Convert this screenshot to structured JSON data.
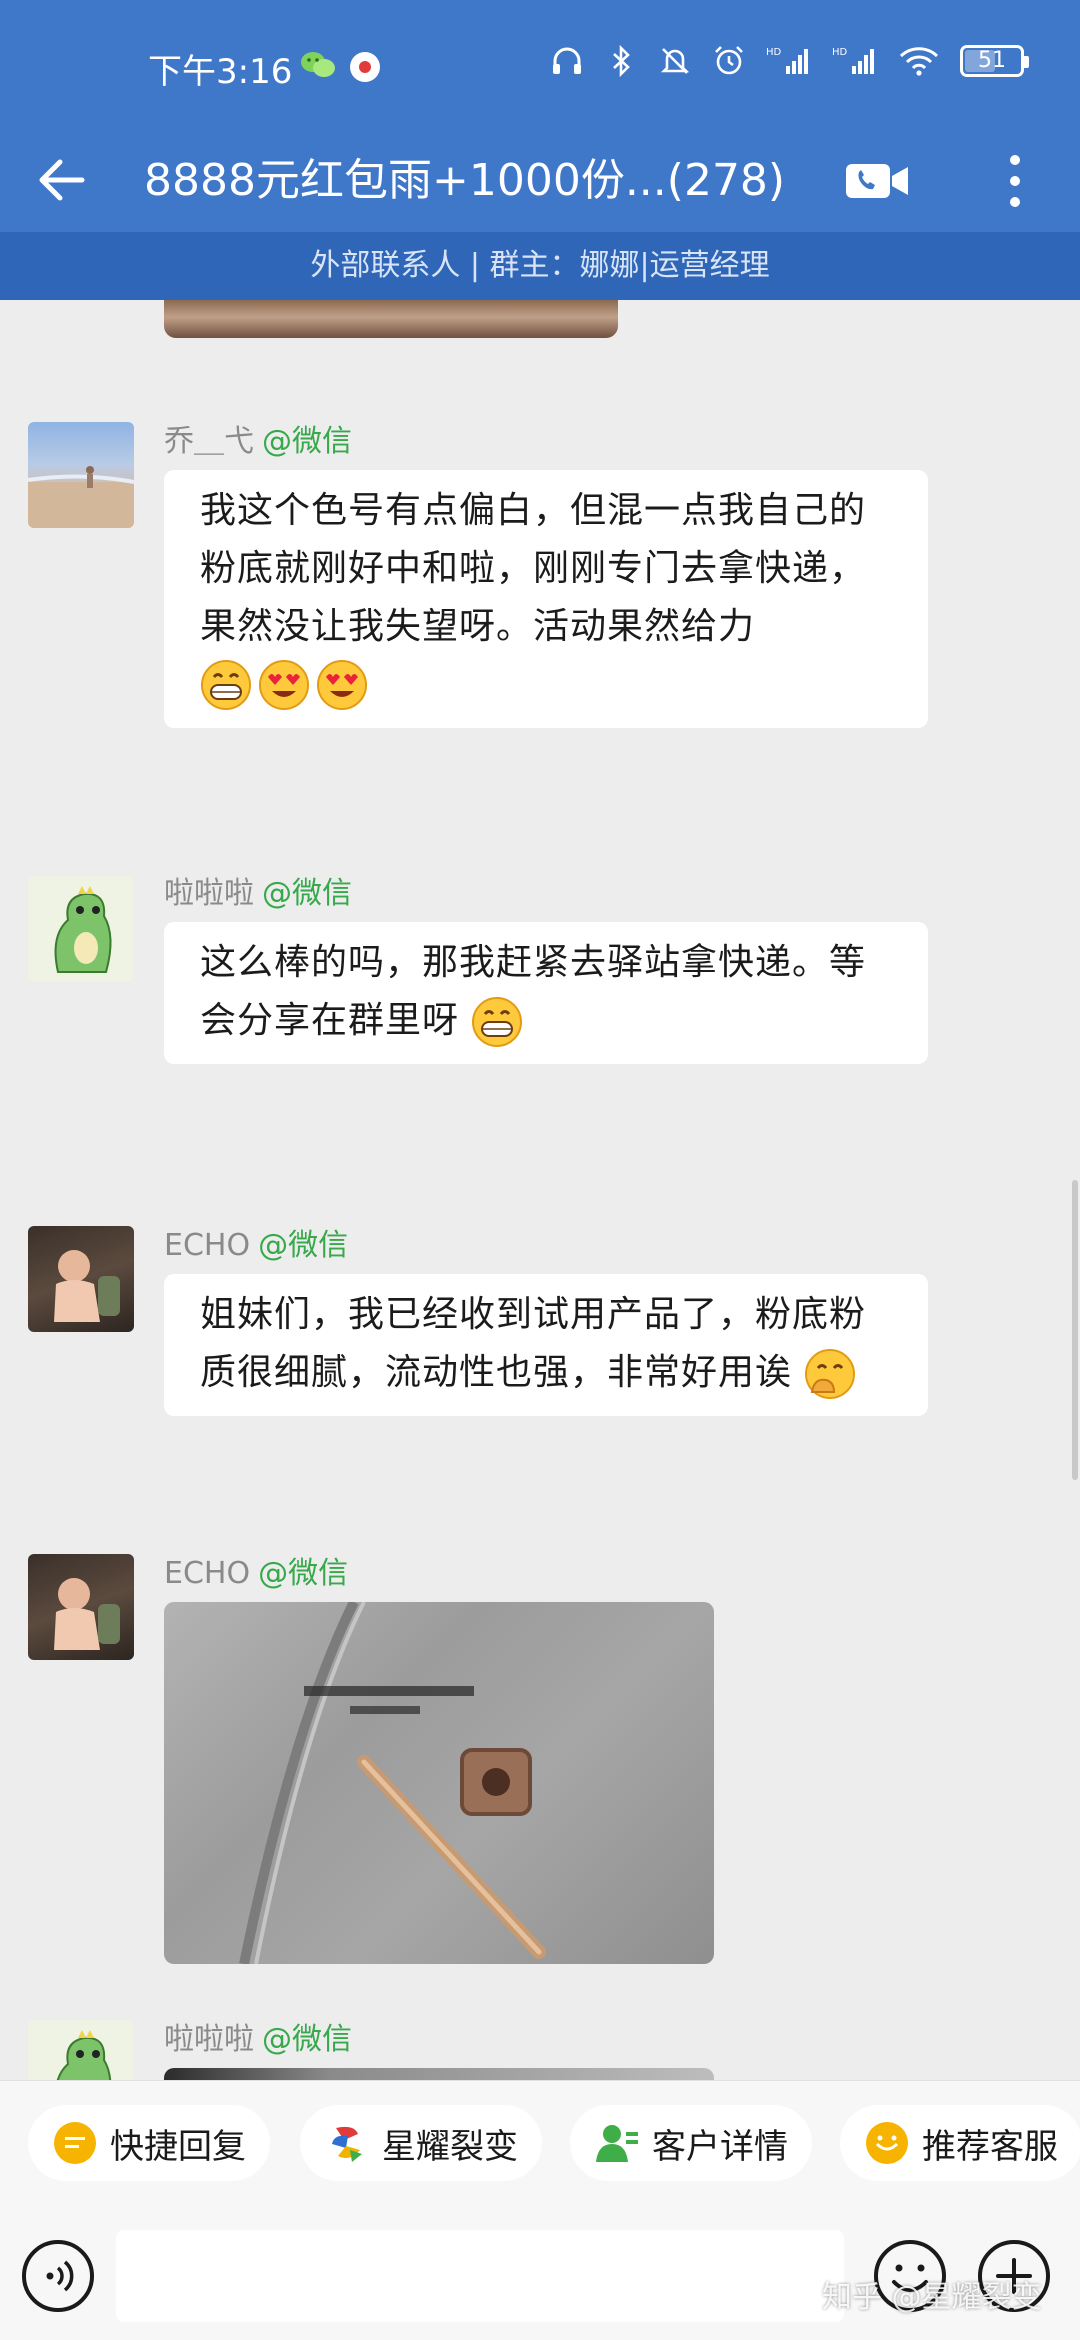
{
  "status_bar": {
    "time": "下午3:16",
    "battery": "51",
    "icons": [
      "wechat-icon",
      "record-icon",
      "headphones-icon",
      "bluetooth-icon",
      "mute-bell-icon",
      "alarm-icon",
      "hd-signal-icon",
      "hd-signal-icon",
      "wifi-icon",
      "battery-icon"
    ]
  },
  "header": {
    "title": "8888元红包雨+1000份...(278)",
    "subtitle": "外部联系人 | 群主：娜娜|运营经理",
    "accent_color": "#3f77c9"
  },
  "messages": [
    {
      "sender": "乔＿弋",
      "source": "@微信",
      "avatar": "beach-photo-avatar",
      "text": "我这个色号有点偏白，但混一点我自己的粉底就刚好中和啦，刚刚专门去拿快递，果然没让我失望呀。活动果然给力",
      "emojis": [
        "grin-emoji",
        "heart-eyes-emoji",
        "heart-eyes-emoji"
      ]
    },
    {
      "sender": "啦啦啦",
      "source": "@微信",
      "avatar": "dinosaur-avatar",
      "text": "这么棒的吗，那我赶紧去驿站拿快递。等会分享在群里呀",
      "emojis": [
        "grin-emoji"
      ]
    },
    {
      "sender": "ECHO",
      "source": "@微信",
      "avatar": "baby-photo-avatar",
      "text": "姐妹们，我已经收到试用产品了，粉底粉质很细腻，流动性也强，非常好用诶",
      "emojis": [
        "hand-over-mouth-emoji"
      ]
    },
    {
      "sender": "ECHO",
      "source": "@微信",
      "avatar": "baby-photo-avatar",
      "image": "product-photo"
    },
    {
      "sender": "啦啦啦",
      "source": "@微信",
      "avatar": "dinosaur-avatar",
      "image": "partial-photo"
    }
  ],
  "quick_actions": [
    {
      "label": "快捷回复",
      "icon": "quick-reply-icon",
      "color": "#f6b400"
    },
    {
      "label": "星耀裂变",
      "icon": "brand-logo-icon",
      "color": "#e03a3a"
    },
    {
      "label": "客户详情",
      "icon": "customer-icon",
      "color": "#3fae49"
    },
    {
      "label": "推荐客服",
      "icon": "service-icon",
      "color": "#f6b400"
    }
  ],
  "input": {
    "placeholder": ""
  },
  "watermark": "知乎 @星耀裂变"
}
